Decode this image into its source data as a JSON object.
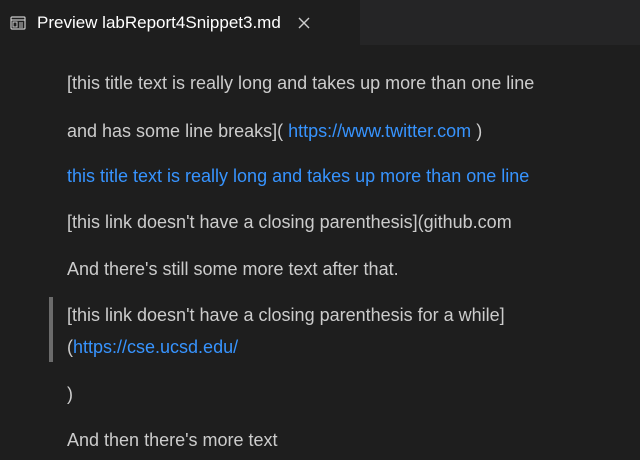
{
  "tab": {
    "icon": "preview-icon",
    "title": "Preview labReport4Snippet3.md",
    "close_icon": "close-icon"
  },
  "content": {
    "line1": "[this title text is really long and takes up more than one line",
    "line2_text": "and has some line breaks]( ",
    "line2_link": "https://www.twitter.com",
    "line2_after": " )",
    "line3_link": "this title text is really long and takes up more than one line",
    "line4": "[this link doesn't have a closing parenthesis](github.com",
    "line5": "And there's still some more text after that.",
    "quote_line1": "[this link doesn't have a closing parenthesis for a while]",
    "quote_line2_text": "(",
    "quote_line2_link": "https://cse.ucsd.edu/",
    "line8": ")",
    "line9": "And then there's more text"
  }
}
